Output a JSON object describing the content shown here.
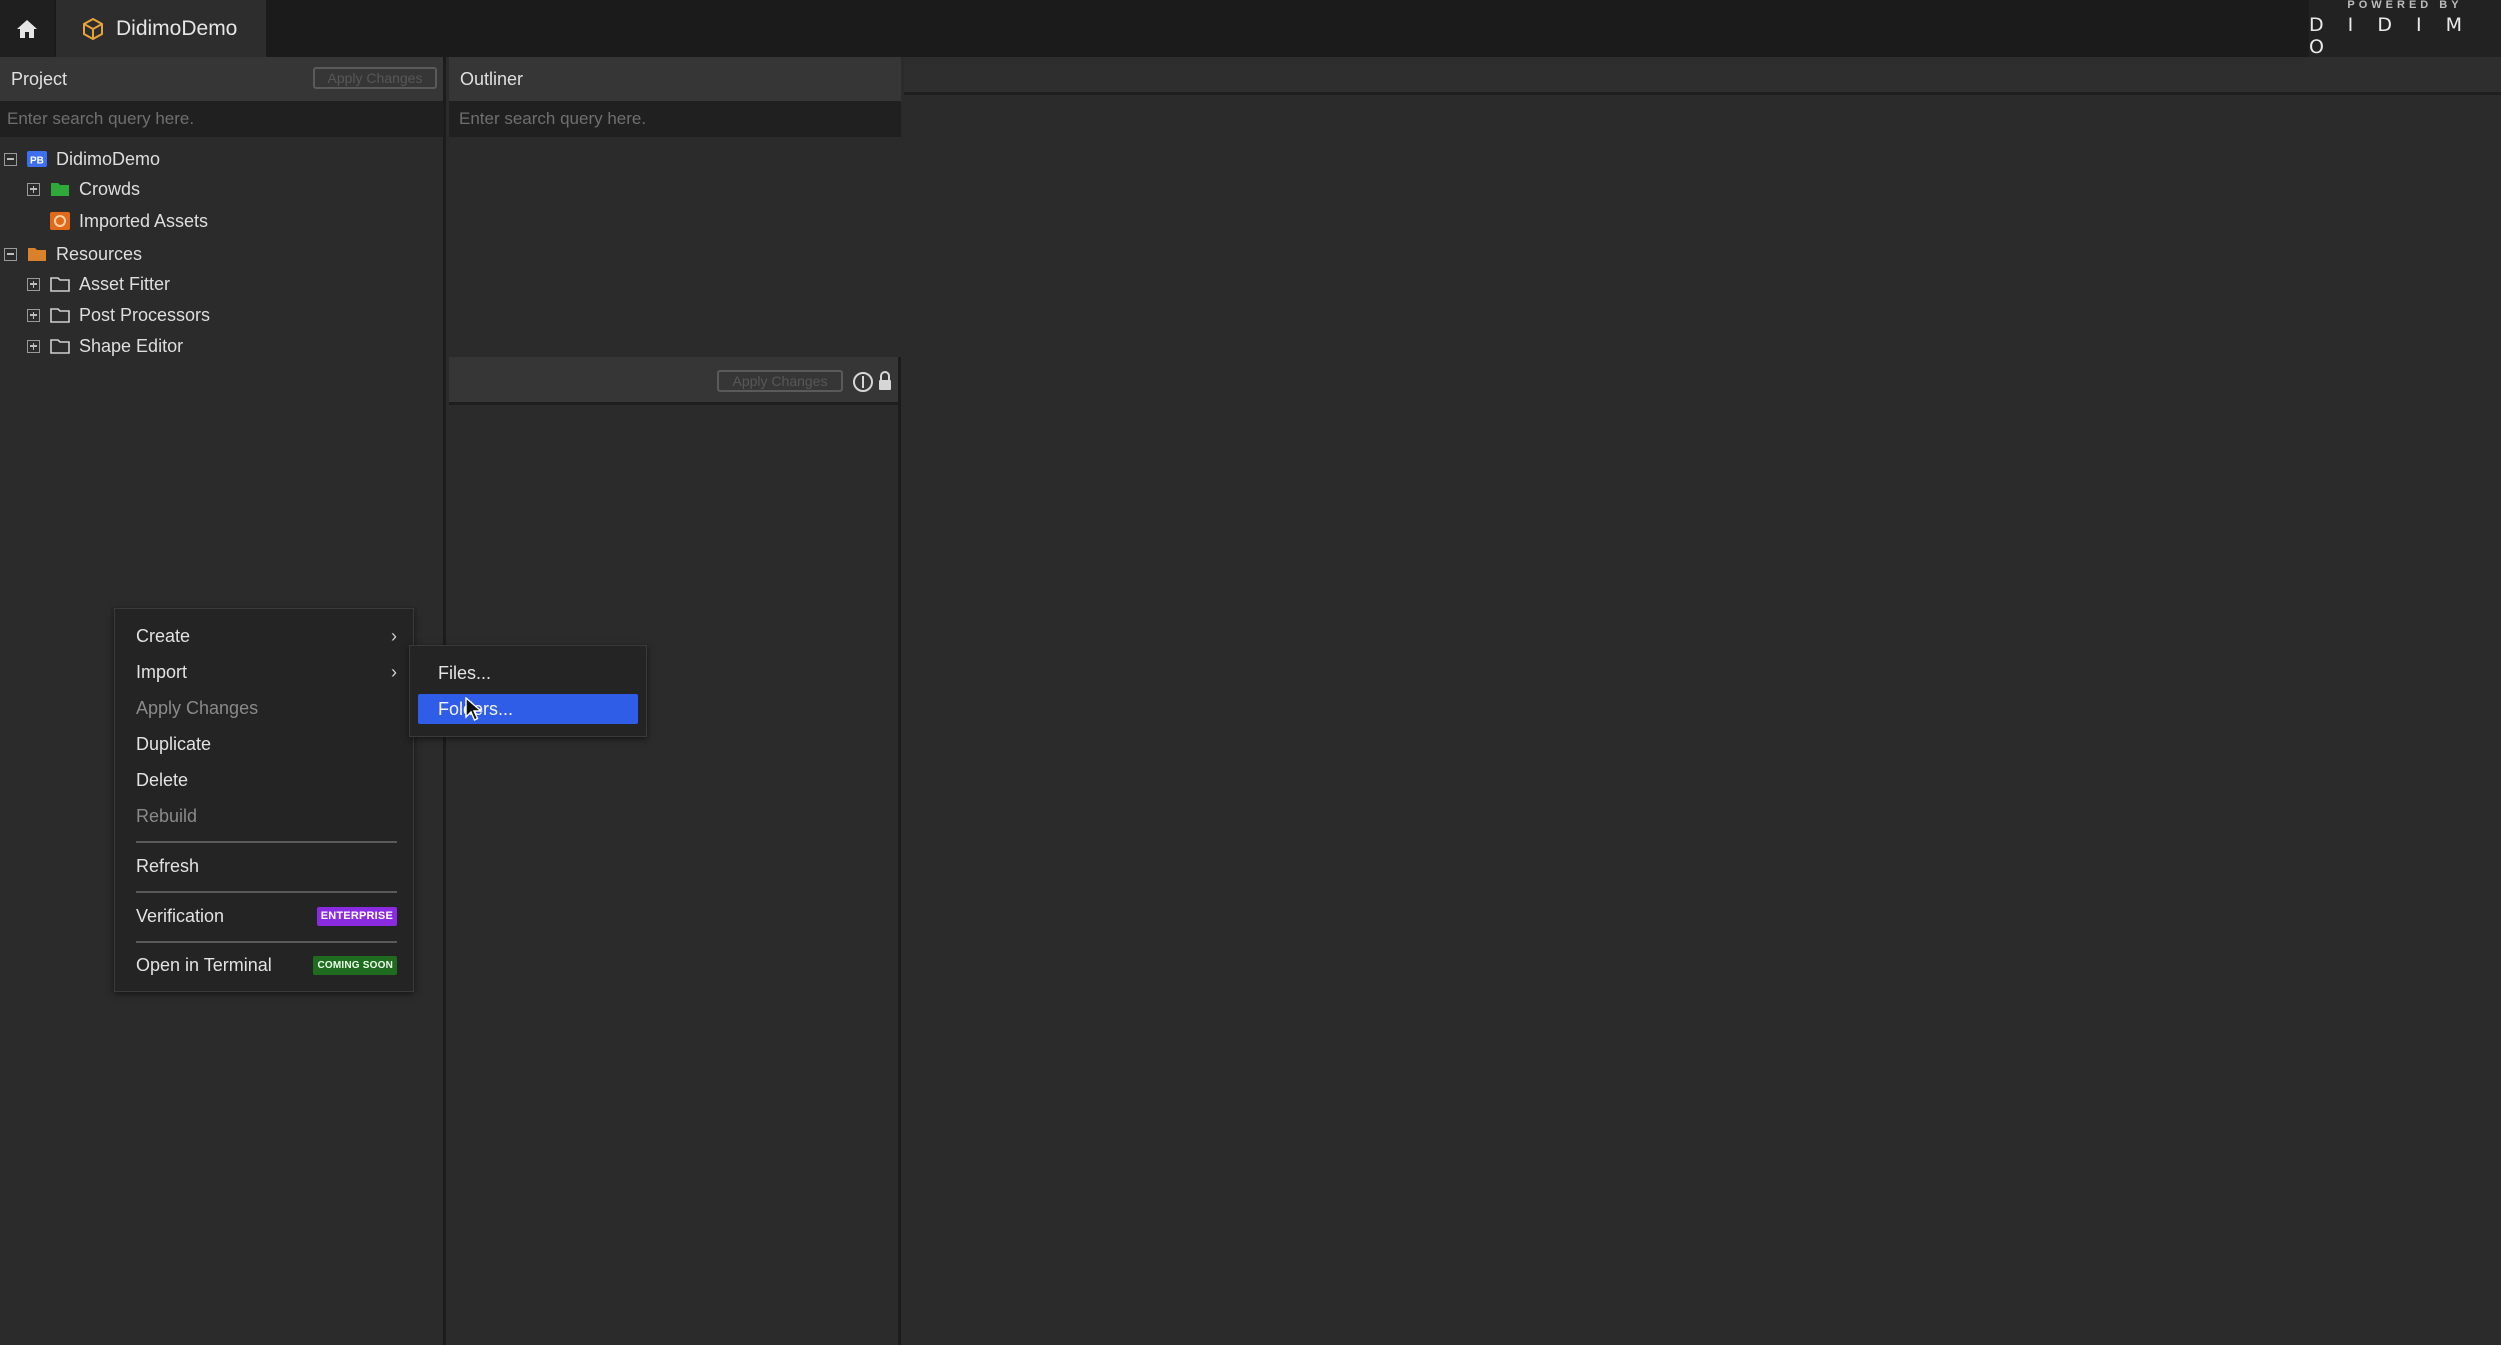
{
  "topbar": {
    "home_icon": "home-icon",
    "tab_icon": "package-icon",
    "tab_title": "DidimoDemo",
    "brand_small": "POWERED BY",
    "brand_logo": "D I D I M O"
  },
  "project_panel": {
    "title": "Project",
    "apply_label": "Apply Changes",
    "search_placeholder": "Enter search query here.",
    "tree": [
      {
        "label": "DidimoDemo",
        "icon": "project-icon",
        "expander": "minus"
      },
      {
        "label": "Crowds",
        "icon": "folder-icon",
        "expander": "plus"
      },
      {
        "label": "Imported Assets",
        "icon": "imported-assets-icon",
        "expander": "none"
      },
      {
        "label": "Resources",
        "icon": "resources-folder-icon",
        "expander": "minus"
      },
      {
        "label": "Asset Fitter",
        "icon": "folder-icon",
        "expander": "plus"
      },
      {
        "label": "Post Processors",
        "icon": "folder-icon",
        "expander": "plus"
      },
      {
        "label": "Shape Editor",
        "icon": "folder-icon",
        "expander": "plus"
      }
    ]
  },
  "outliner_panel": {
    "title": "Outliner",
    "search_placeholder": "Enter search query here."
  },
  "properties_panel": {
    "apply_label": "Apply Changes",
    "info_icon": "info-icon",
    "lock_icon": "lock-icon"
  },
  "context_menu": {
    "items": [
      {
        "label": "Create",
        "submenu": true,
        "disabled": false
      },
      {
        "label": "Import",
        "submenu": true,
        "disabled": false
      },
      {
        "label": "Apply Changes",
        "disabled": true
      },
      {
        "label": "Duplicate",
        "disabled": false
      },
      {
        "label": "Delete",
        "disabled": false
      },
      {
        "label": "Rebuild",
        "disabled": true
      },
      {
        "label": "Refresh",
        "disabled": false
      },
      {
        "label": "Verification",
        "badge": "ENTERPRISE"
      },
      {
        "label": "Open in Terminal",
        "badge": "COMING SOON"
      }
    ]
  },
  "import_submenu": {
    "items": [
      {
        "label": "Files...",
        "active": false
      },
      {
        "label": "Folders...",
        "active": true
      }
    ]
  },
  "colors": {
    "accent": "#2f5de8",
    "enterprise_badge": "#8a2be2",
    "coming_soon_badge": "#1f6b1f"
  }
}
